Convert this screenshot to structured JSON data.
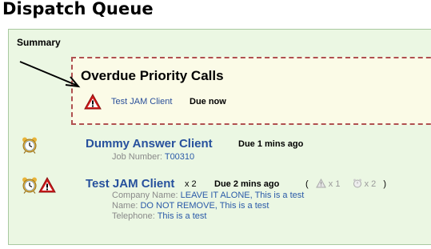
{
  "page": {
    "title": "Dispatch Queue"
  },
  "summary": {
    "heading": "Summary",
    "overdue": {
      "title": "Overdue Priority Calls",
      "calls": [
        {
          "client": "Test JAM Client",
          "due": "Due now",
          "icon": "warning-icon"
        }
      ]
    }
  },
  "queue": [
    {
      "client": "Dummy Answer Client",
      "due": "Due 1 mins ago",
      "icons": [
        "alarm-clock-icon"
      ],
      "details": [
        {
          "label": "Job Number:",
          "values": [
            "T00310"
          ]
        }
      ]
    },
    {
      "client": "Test JAM Client",
      "multiplier": "x 2",
      "due": "Due 2 mins ago",
      "icons": [
        "alarm-clock-icon",
        "warning-icon"
      ],
      "counts": {
        "open_paren": "(",
        "warning_count": "x 1",
        "alarm_count": "x 2",
        "close_paren": ")"
      },
      "details": [
        {
          "label": "Company Name:",
          "values": [
            "LEAVE IT ALONE",
            ", ",
            "This is a test"
          ]
        },
        {
          "label": "Name:",
          "values": [
            "DO NOT REMOVE",
            ", ",
            "This is a test"
          ]
        },
        {
          "label": "Telephone:",
          "values": [
            "This is a test"
          ]
        }
      ]
    }
  ],
  "colors": {
    "panel_bg": "#ebf7e3",
    "overdue_bg": "#fbfbe7",
    "overdue_border": "#b05050",
    "link": "#27519d"
  }
}
